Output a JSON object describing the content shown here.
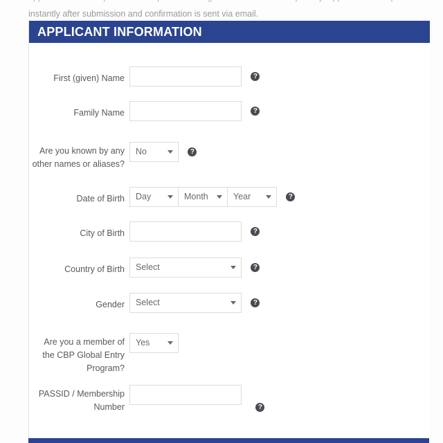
{
  "intro": {
    "line1": "application. Please provide all responses in English. All fields are compulsory. Applications are processed",
    "line2": "instantly after submission and confirmation is sent via email."
  },
  "section": {
    "title": "APPLICANT INFORMATION",
    "header_color": "#2b4490"
  },
  "fields": [
    {
      "name": "first-name",
      "label": "First (given) Name",
      "type": "text",
      "value": "",
      "placeholder": "",
      "help": "?"
    },
    {
      "name": "family-name",
      "label": "Family Name",
      "type": "text",
      "value": "",
      "placeholder": "",
      "help": "?"
    },
    {
      "name": "aliases",
      "label_line1": "Are you known by any",
      "label_line2": "other names or aliases?",
      "type": "select",
      "value": "No",
      "help": "?"
    },
    {
      "name": "date-of-birth",
      "label": "Date of Birth",
      "type": "select-triple",
      "day": "Day",
      "month": "Month",
      "year": "Year",
      "help": "?"
    },
    {
      "name": "city-of-birth",
      "label": "City of Birth",
      "type": "text",
      "value": "",
      "placeholder": "",
      "help": "?"
    },
    {
      "name": "country-of-birth",
      "label": "Country of Birth",
      "type": "select",
      "value": "Select",
      "help": "?"
    },
    {
      "name": "gender",
      "label": "Gender",
      "type": "select",
      "value": "Select",
      "help": "?"
    },
    {
      "name": "cbp-global-entry",
      "label_line1": "Are you a member of",
      "label_line2": "the CBP Global Entry",
      "label_line3": "Program?",
      "type": "select",
      "value": "Yes"
    },
    {
      "name": "passid",
      "label_line1": "PASSID / Membership",
      "label_line2": "Number",
      "type": "text",
      "value": "",
      "placeholder": "",
      "help": "?"
    }
  ]
}
